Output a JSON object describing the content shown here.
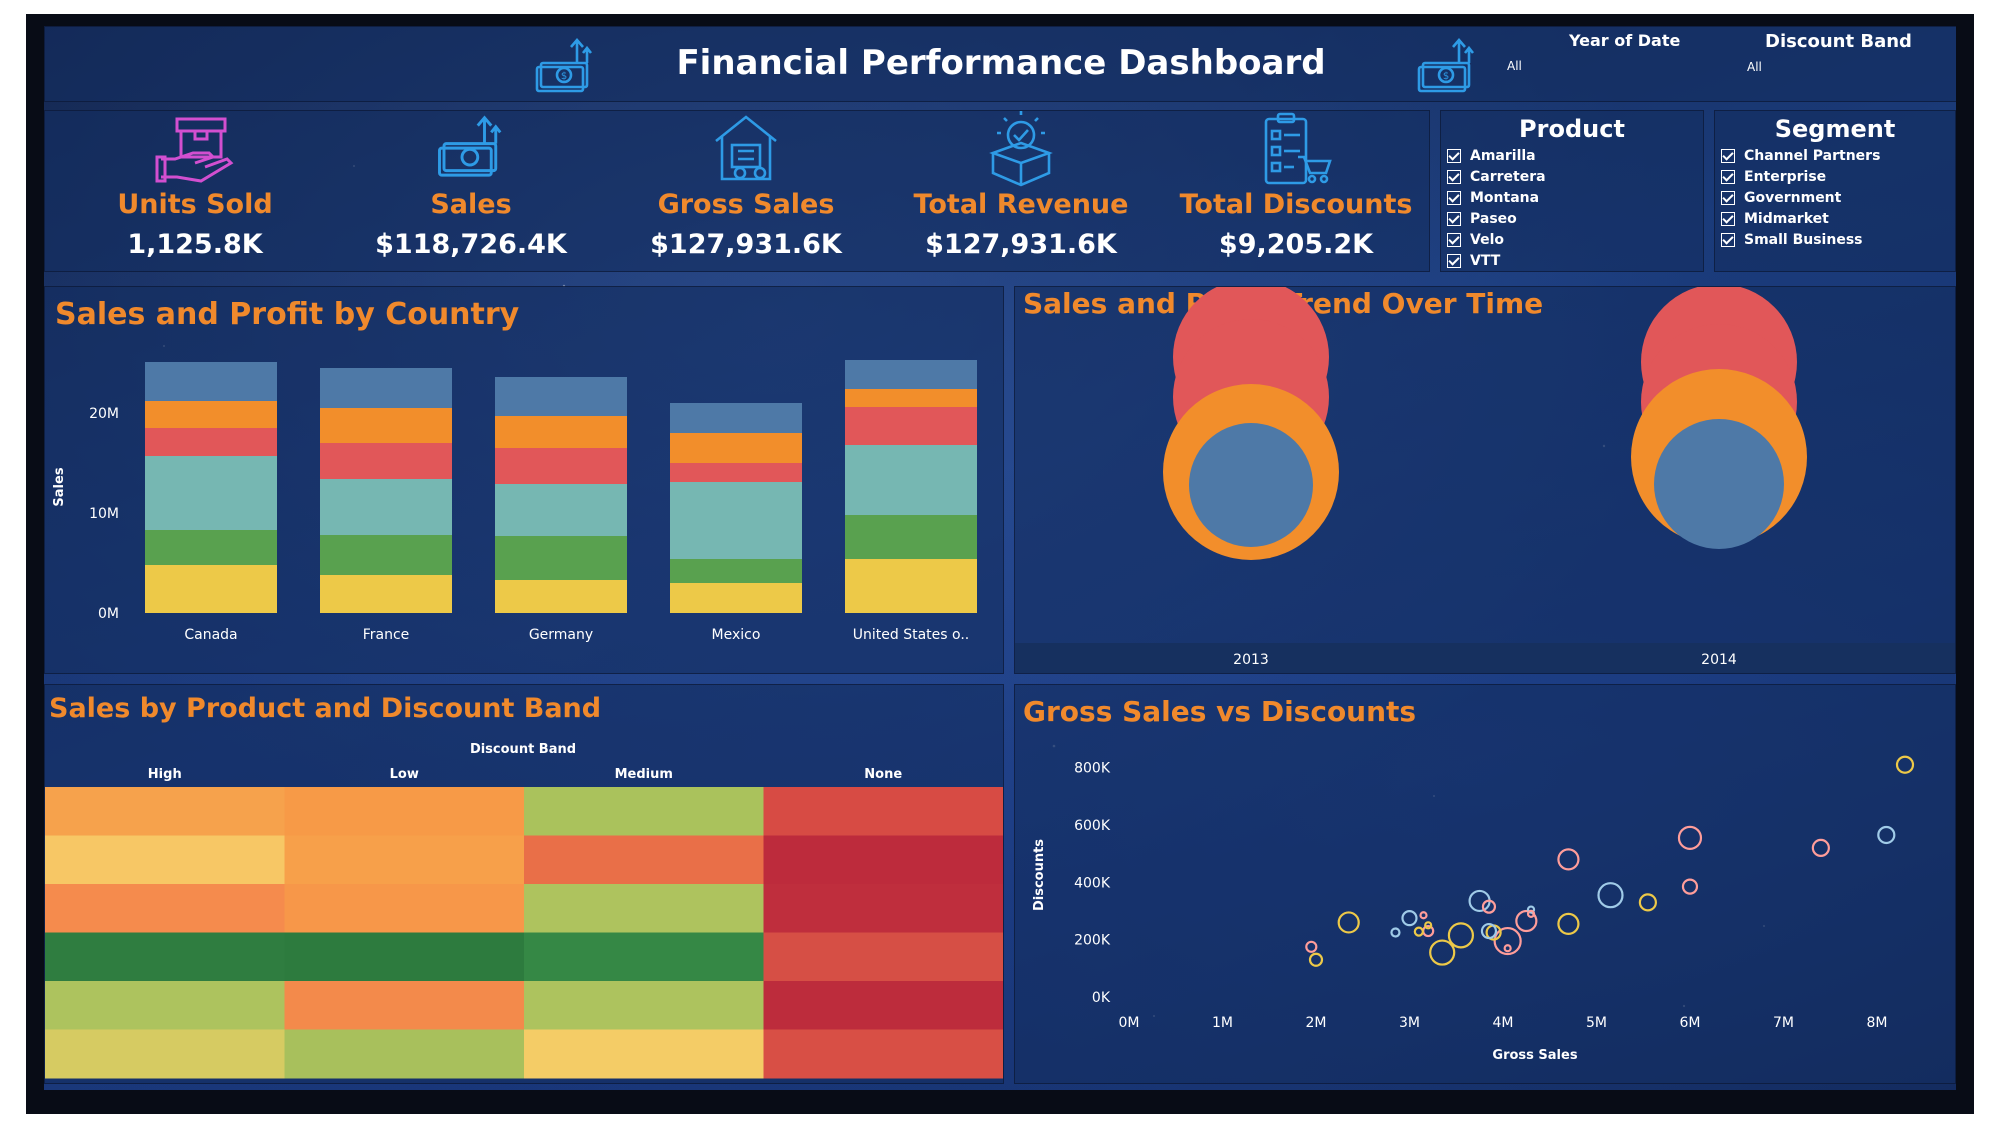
{
  "header": {
    "title": "Financial Performance Dashboard"
  },
  "filters": {
    "year": {
      "label": "Year of Date",
      "value": "All"
    },
    "discount_band": {
      "label": "Discount Band",
      "value": "All"
    }
  },
  "kpis": [
    {
      "label": "Units Sold",
      "value": "1,125.8K",
      "icon": "hand-box-icon",
      "color": "#d24fd0"
    },
    {
      "label": "Sales",
      "value": "$118,726.4K",
      "icon": "money-upload-icon",
      "color": "#2e9be6"
    },
    {
      "label": "Gross Sales",
      "value": "$127,931.6K",
      "icon": "warehouse-icon",
      "color": "#2e9be6"
    },
    {
      "label": "Total Revenue",
      "value": "$127,931.6K",
      "icon": "box-check-icon",
      "color": "#2e9be6"
    },
    {
      "label": "Total Discounts",
      "value": "$9,205.2K",
      "icon": "checklist-cart-icon",
      "color": "#2e9be6"
    }
  ],
  "product_filter": {
    "title": "Product",
    "items": [
      "Amarilla",
      "Carretera",
      "Montana",
      "Paseo",
      "Velo",
      "VTT"
    ]
  },
  "segment_filter": {
    "title": "Segment",
    "items": [
      "Channel Partners",
      "Enterprise",
      "Government",
      "Midmarket",
      "Small Business"
    ]
  },
  "colors": {
    "blue": "#4e79a7",
    "orange": "#f28e2b",
    "red": "#e15759",
    "teal": "#76b7b2",
    "green": "#59a14f",
    "yellow": "#edc948",
    "title_orange": "#f0892c"
  },
  "panels": {
    "country": {
      "title": "Sales and Profit by Country"
    },
    "trend": {
      "title": "Sales and Profit Trend Over Time"
    },
    "heatmap": {
      "title": "Sales by Product and Discount Band"
    },
    "scatter": {
      "title": "Gross Sales vs Discounts"
    }
  },
  "chart_data": [
    {
      "type": "bar",
      "title": "Sales and Profit by Country",
      "ylabel": "Sales",
      "categories": [
        "Canada",
        "France",
        "Germany",
        "Mexico",
        "United States o.."
      ],
      "ticks": [
        "0M",
        "10M",
        "20M"
      ],
      "ylim": [
        0,
        26
      ],
      "stacked": true,
      "series": [
        {
          "color": "#edc948",
          "values": [
            4.8,
            3.8,
            3.3,
            3.0,
            5.4
          ]
        },
        {
          "color": "#59a14f",
          "values": [
            3.5,
            4.0,
            4.4,
            2.4,
            4.4
          ]
        },
        {
          "color": "#76b7b2",
          "values": [
            7.4,
            5.6,
            5.2,
            7.7,
            7.0
          ]
        },
        {
          "color": "#e15759",
          "values": [
            2.8,
            3.6,
            3.6,
            1.9,
            3.8
          ]
        },
        {
          "color": "#f28e2b",
          "values": [
            2.7,
            3.5,
            3.2,
            3.0,
            1.8
          ]
        },
        {
          "color": "#4e79a7",
          "values": [
            3.9,
            4.0,
            3.9,
            3.0,
            2.9
          ]
        }
      ]
    },
    {
      "type": "scatter",
      "title": "Sales and Profit Trend Over Time",
      "categories": [
        "2013",
        "2014"
      ],
      "series": [
        {
          "color": "#e15759",
          "bubbles": [
            [
              0,
              340,
              78
            ],
            [
              0,
              380,
              78
            ]
          ]
        },
        {
          "color": "#e15759",
          "bubbles": [
            [
              1,
              345,
              78
            ],
            [
              1,
              385,
              78
            ]
          ]
        },
        {
          "color": "#f28e2b",
          "bubbles": [
            [
              0,
              455,
              88
            ],
            [
              1,
              440,
              88
            ]
          ]
        },
        {
          "color": "#4e79a7",
          "bubbles": [
            [
              0,
              468,
              62
            ],
            [
              1,
              467,
              65
            ]
          ]
        }
      ]
    },
    {
      "type": "heatmap",
      "title": "Sales by Product and Discount Band",
      "column_header": "Discount Band",
      "columns": [
        "High",
        "Low",
        "Medium",
        "None"
      ],
      "rows": 6,
      "cells": [
        [
          "#f6a24c",
          "#f79a47",
          "#aac25c",
          "#d74b44"
        ],
        [
          "#f7c765",
          "#f7a04a",
          "#e96f48",
          "#bd2b3c"
        ],
        [
          "#f58b4d",
          "#f79749",
          "#aec35e",
          "#bf2e3d"
        ],
        [
          "#2f7d40",
          "#2d7b3e",
          "#358845",
          "#d64f45"
        ],
        [
          "#adc35e",
          "#f38a4b",
          "#adc35e",
          "#bd2c3c"
        ],
        [
          "#d6cb62",
          "#a8c05c",
          "#f4cc66",
          "#d84f45"
        ]
      ]
    },
    {
      "type": "scatter",
      "title": "Gross Sales vs Discounts",
      "xlabel": "Gross Sales",
      "ylabel": "Discounts",
      "xticks": [
        "0M",
        "1M",
        "2M",
        "3M",
        "4M",
        "5M",
        "6M",
        "7M",
        "8M"
      ],
      "yticks": [
        "0K",
        "200K",
        "400K",
        "600K",
        "800K"
      ],
      "xlim": [
        0,
        8.3
      ],
      "ylim": [
        0,
        830
      ],
      "points": [
        {
          "x": 8.3,
          "y": 810,
          "r": 8,
          "color": "#edc948"
        },
        {
          "x": 8.1,
          "y": 565,
          "r": 8,
          "color": "#a0cbe8"
        },
        {
          "x": 7.4,
          "y": 520,
          "r": 8,
          "color": "#ff9d9a"
        },
        {
          "x": 6.0,
          "y": 555,
          "r": 11,
          "color": "#ff9d9a"
        },
        {
          "x": 6.0,
          "y": 385,
          "r": 7,
          "color": "#ff9d9a"
        },
        {
          "x": 5.55,
          "y": 330,
          "r": 8,
          "color": "#edc948"
        },
        {
          "x": 5.15,
          "y": 355,
          "r": 12,
          "color": "#a0cbe8"
        },
        {
          "x": 4.7,
          "y": 480,
          "r": 10,
          "color": "#ff9d9a"
        },
        {
          "x": 4.7,
          "y": 255,
          "r": 10,
          "color": "#edc948"
        },
        {
          "x": 4.25,
          "y": 265,
          "r": 10,
          "color": "#ff9d9a"
        },
        {
          "x": 4.3,
          "y": 305,
          "r": 3,
          "color": "#a0cbe8"
        },
        {
          "x": 4.3,
          "y": 290,
          "r": 3,
          "color": "#ff9d9a"
        },
        {
          "x": 4.05,
          "y": 195,
          "r": 13,
          "color": "#ff9d9a"
        },
        {
          "x": 4.05,
          "y": 170,
          "r": 3,
          "color": "#ff9d9a"
        },
        {
          "x": 3.9,
          "y": 225,
          "r": 7,
          "color": "#edc948"
        },
        {
          "x": 3.75,
          "y": 335,
          "r": 10,
          "color": "#a0cbe8"
        },
        {
          "x": 3.85,
          "y": 315,
          "r": 6,
          "color": "#ff9d9a"
        },
        {
          "x": 3.85,
          "y": 230,
          "r": 7,
          "color": "#a0cbe8"
        },
        {
          "x": 3.55,
          "y": 215,
          "r": 12,
          "color": "#edc948"
        },
        {
          "x": 3.35,
          "y": 155,
          "r": 12,
          "color": "#edc948"
        },
        {
          "x": 3.2,
          "y": 230,
          "r": 5,
          "color": "#ff9d9a"
        },
        {
          "x": 3.0,
          "y": 275,
          "r": 7,
          "color": "#a0cbe8"
        },
        {
          "x": 3.15,
          "y": 285,
          "r": 3,
          "color": "#ff9d9a"
        },
        {
          "x": 3.2,
          "y": 250,
          "r": 3,
          "color": "#edc948"
        },
        {
          "x": 3.1,
          "y": 228,
          "r": 4,
          "color": "#edc948"
        },
        {
          "x": 2.85,
          "y": 225,
          "r": 4,
          "color": "#a0cbe8"
        },
        {
          "x": 2.35,
          "y": 260,
          "r": 10,
          "color": "#edc948"
        },
        {
          "x": 1.95,
          "y": 175,
          "r": 5,
          "color": "#ff9d9a"
        },
        {
          "x": 2.0,
          "y": 130,
          "r": 6,
          "color": "#edc948"
        }
      ]
    }
  ]
}
